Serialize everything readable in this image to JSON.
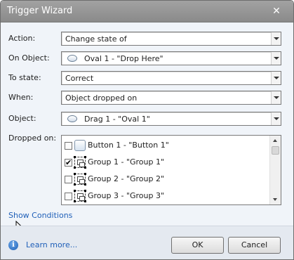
{
  "window": {
    "title": "Trigger Wizard"
  },
  "form": {
    "action": {
      "label": "Action:",
      "value": "Change state of"
    },
    "on_object": {
      "label": "On Object:",
      "value": "Oval 1 - \"Drop Here\"",
      "icon": "oval-icon"
    },
    "to_state": {
      "label": "To state:",
      "value": "Correct"
    },
    "when": {
      "label": "When:",
      "value": "Object dropped on"
    },
    "object": {
      "label": "Object:",
      "value": "Drag 1 - \"Oval 1\"",
      "icon": "oval-icon"
    },
    "dropped_on": {
      "label": "Dropped on:",
      "items": [
        {
          "label": "Button 1 - \"Button 1\"",
          "checked": false,
          "icon": "button-shape-icon"
        },
        {
          "label": "Group 1 - \"Group 1\"",
          "checked": true,
          "icon": "group-icon"
        },
        {
          "label": "Group 2 - \"Group 2\"",
          "checked": false,
          "icon": "group-icon"
        },
        {
          "label": "Group 3 - \"Group 3\"",
          "checked": false,
          "icon": "group-icon"
        }
      ]
    },
    "show_conditions": "Show Conditions"
  },
  "footer": {
    "learn_more": "Learn more...",
    "ok_label": "OK",
    "cancel_label": "Cancel"
  },
  "check_mark": "✔",
  "close_glyph": "✕",
  "info_glyph": "i",
  "colors": {
    "link": "#1f5fb8",
    "titlebar": "#939393"
  }
}
